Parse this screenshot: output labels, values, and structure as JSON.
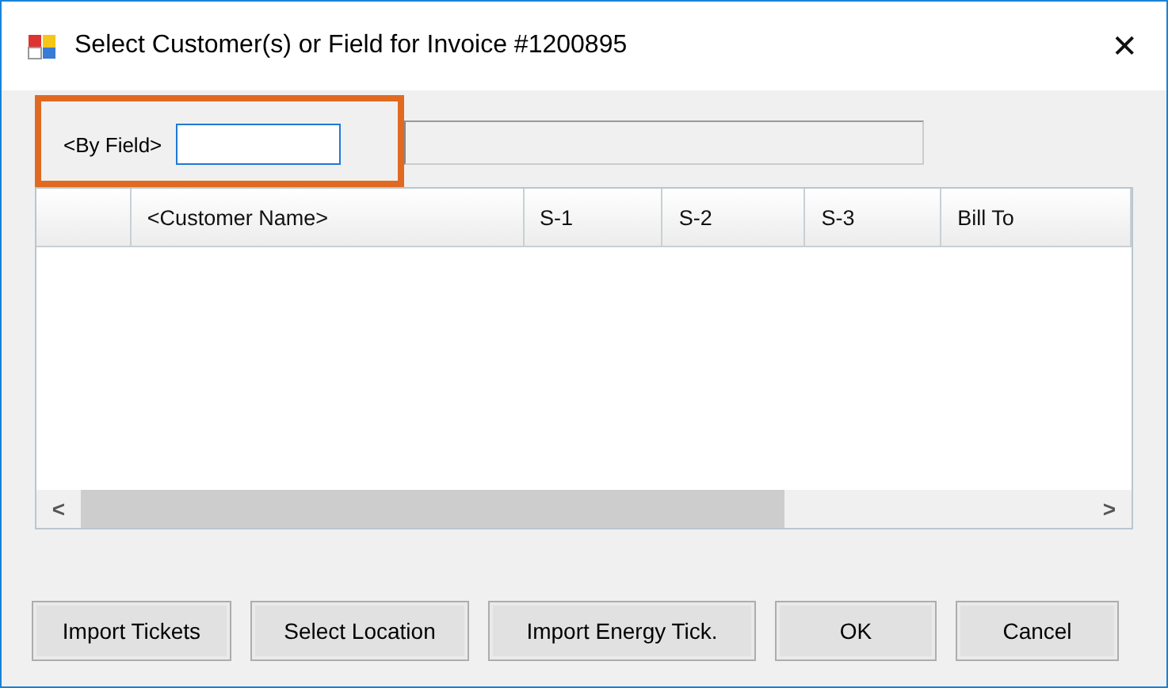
{
  "window": {
    "title": "Select Customer(s) or Field for Invoice #1200895",
    "close": "✕"
  },
  "filter": {
    "label": "<By Field>",
    "highlighted": true
  },
  "table": {
    "columns": [
      {
        "label": "<Customer Name>"
      },
      {
        "label": "S-1"
      },
      {
        "label": "S-2"
      },
      {
        "label": "S-3"
      },
      {
        "label": "Bill To"
      }
    ],
    "scroll_left": "<",
    "scroll_right": ">"
  },
  "buttons": [
    "Import Tickets",
    "Select Location",
    "Import Energy Tick.",
    "OK",
    "Cancel"
  ]
}
